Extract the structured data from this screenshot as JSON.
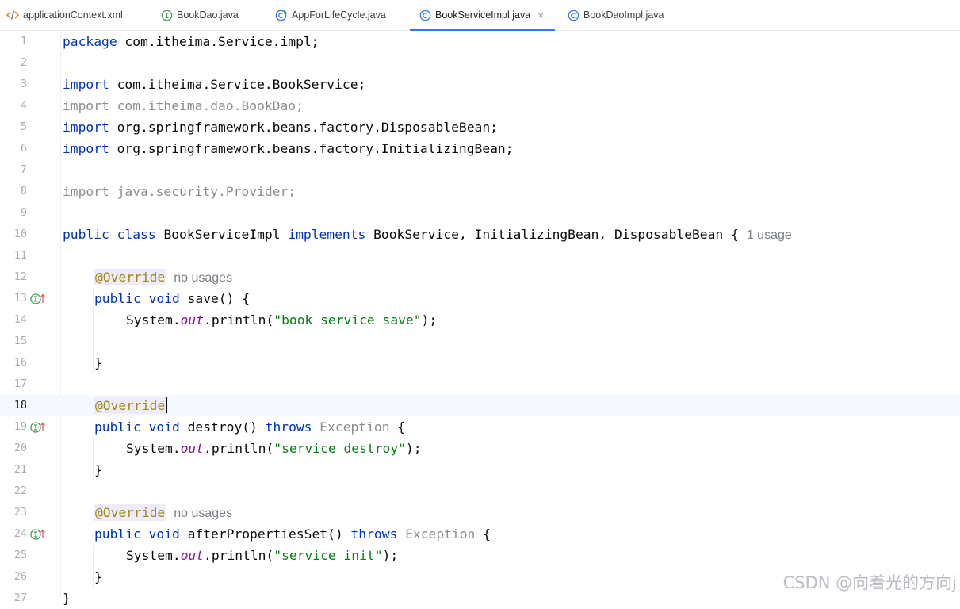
{
  "tabs": [
    {
      "label": "applicationContext.xml",
      "icon": "xml-file-icon",
      "active": false
    },
    {
      "label": "BookDao.java",
      "icon": "interface-icon",
      "active": false
    },
    {
      "label": "AppForLifeCycle.java",
      "icon": "runnable-class-icon",
      "active": false
    },
    {
      "label": "BookServiceImpl.java",
      "icon": "class-icon",
      "active": true,
      "close": "×"
    },
    {
      "label": "BookDaoImpl.java",
      "icon": "class-icon",
      "active": false
    }
  ],
  "editor": {
    "current_line": 18,
    "lines": [
      {
        "n": "1",
        "code": [
          "package",
          " com.itheima.Service.impl;"
        ]
      },
      {
        "n": "2"
      },
      {
        "n": "3",
        "code": [
          "import",
          " com.itheima.Service.BookService;"
        ]
      },
      {
        "n": "4",
        "code": "import com.itheima.dao.BookDao;"
      },
      {
        "n": "5",
        "code": [
          "import",
          " org.springframework.beans.factory.DisposableBean;"
        ]
      },
      {
        "n": "6",
        "code": [
          "import",
          " org.springframework.beans.factory.InitializingBean;"
        ]
      },
      {
        "n": "7"
      },
      {
        "n": "8",
        "code": "import java.security.Provider;"
      },
      {
        "n": "9"
      },
      {
        "n": "10",
        "code": [
          "public class",
          " BookServiceImpl ",
          "implements",
          " BookService, InitializingBean, DisposableBean {"
        ],
        "hint": "1 usage"
      },
      {
        "n": "11"
      },
      {
        "n": "12",
        "code": "@Override",
        "hint": "no usages"
      },
      {
        "n": "13",
        "code": [
          "public void",
          " save() {"
        ]
      },
      {
        "n": "14",
        "code": [
          "System.",
          "out",
          ".println(",
          "\"book service save\"",
          ");"
        ]
      },
      {
        "n": "15"
      },
      {
        "n": "16",
        "code": "}"
      },
      {
        "n": "17"
      },
      {
        "n": "18",
        "code": "@Override"
      },
      {
        "n": "19",
        "code": [
          "public void",
          " destroy() ",
          "throws",
          " Exception",
          " {"
        ]
      },
      {
        "n": "20",
        "code": [
          "System.",
          "out",
          ".println(",
          "\"service destroy\"",
          ");"
        ]
      },
      {
        "n": "21",
        "code": "}"
      },
      {
        "n": "22"
      },
      {
        "n": "23",
        "code": "@Override",
        "hint": "no usages"
      },
      {
        "n": "24",
        "code": [
          "public void",
          " afterPropertiesSet() ",
          "throws",
          " Exception",
          " {"
        ]
      },
      {
        "n": "25",
        "code": [
          "System.",
          "out",
          ".println(",
          "\"service init\"",
          ");"
        ]
      },
      {
        "n": "26",
        "code": "}"
      },
      {
        "n": "27",
        "code": "}"
      }
    ],
    "gutter_icons": {
      "13": "implements-method-icon",
      "19": "implements-method-icon",
      "24": "implements-method-icon"
    }
  },
  "watermark": "CSDN @向着光的方向j",
  "colors": {
    "keyword": "#0033b3",
    "string": "#067d17",
    "annotation": "#9e880d",
    "static_field": "#871094",
    "unused": "#8c8c8c",
    "accent": "#3574f0"
  }
}
